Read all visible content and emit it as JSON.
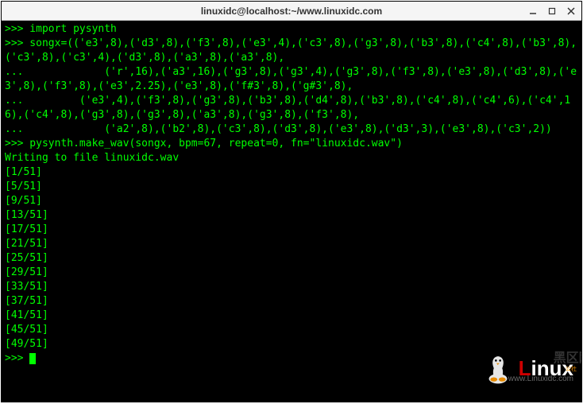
{
  "window": {
    "title": "linuxidc@localhost:~/www.linuxidc.com"
  },
  "terminal": {
    "prompt": ">>> ",
    "continuation": "... ",
    "lines": [
      ">>> import pysynth",
      ">>> songx=(('e3',8),('d3',8),('f3',8),('e3',4),('c3',8),('g3',8),('b3',8),('c4',8),('b3',8),('c3',8),('c3',4),('d3',8),('a3',8),('a3',8),",
      "...             ('r',16),('a3',16),('g3',8),('g3',4),('g3',8),('f3',8),('e3',8),('d3',8),('e3',8),('f3',8),('e3',2.25),('e3',8),('f#3',8),('g#3',8),",
      "...         ('e3',4),('f3',8),('g3',8),('b3',8),('d4',8),('b3',8),('c4',8),('c4',6),('c4',16),('c4',8),('g3',8),('g3',8),('a3',8),('g3',8),('f3',8),",
      "...             ('a2',8),('b2',8),('c3',8),('d3',8),('e3',8),('d3',3),('e3',8),('c3',2))",
      ">>> pysynth.make_wav(songx, bpm=67, repeat=0, fn=\"linuxidc.wav\")",
      "Writing to file linuxidc.wav",
      "[1/51]",
      "[5/51]",
      "[9/51]",
      "[13/51]",
      "[17/51]",
      "[21/51]",
      "[25/51]",
      "[29/51]",
      "[33/51]",
      "[37/51]",
      "[41/51]",
      "[45/51]",
      "[49/51]",
      "",
      ">>> "
    ]
  },
  "watermark": {
    "chinese": "黑区网络",
    "brand_l": "L",
    "brand_inux": "inux",
    "url": "www.Linuxidc.com",
    "sub": "公社"
  }
}
